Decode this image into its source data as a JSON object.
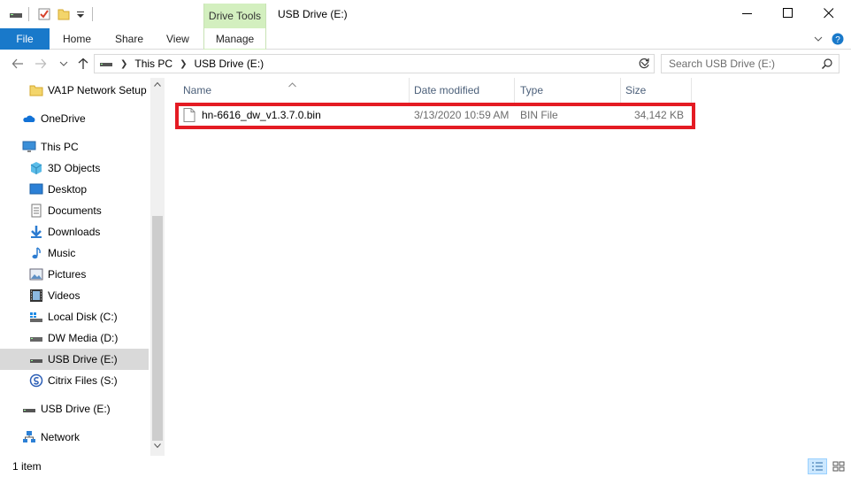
{
  "window": {
    "title": "USB Drive (E:)",
    "context_tab_group": "Drive Tools"
  },
  "ribbon": {
    "tabs": [
      {
        "label": "File"
      },
      {
        "label": "Home"
      },
      {
        "label": "Share"
      },
      {
        "label": "View"
      },
      {
        "label": "Manage"
      }
    ]
  },
  "address": {
    "breadcrumbs": [
      "This PC",
      "USB Drive (E:)"
    ]
  },
  "search": {
    "placeholder": "Search USB Drive (E:)"
  },
  "navpane": {
    "items": [
      {
        "label": "VA1P Network Setup",
        "icon": "folder-icon"
      },
      {
        "label": "OneDrive",
        "icon": "cloud-icon"
      },
      {
        "label": "This PC",
        "icon": "computer-icon"
      },
      {
        "label": "3D Objects",
        "icon": "cube-icon"
      },
      {
        "label": "Desktop",
        "icon": "desktop-icon"
      },
      {
        "label": "Documents",
        "icon": "document-icon"
      },
      {
        "label": "Downloads",
        "icon": "download-arrow-icon"
      },
      {
        "label": "Music",
        "icon": "music-note-icon"
      },
      {
        "label": "Pictures",
        "icon": "picture-icon"
      },
      {
        "label": "Videos",
        "icon": "film-icon"
      },
      {
        "label": "Local Disk (C:)",
        "icon": "windows-drive-icon"
      },
      {
        "label": "DW Media (D:)",
        "icon": "drive-icon"
      },
      {
        "label": "USB Drive (E:)",
        "icon": "usb-drive-icon",
        "selected": true
      },
      {
        "label": "Citrix Files (S:)",
        "icon": "citrix-icon"
      },
      {
        "label": "USB Drive (E:)",
        "icon": "usb-drive-icon"
      },
      {
        "label": "Network",
        "icon": "network-icon"
      }
    ]
  },
  "columns": [
    "Name",
    "Date modified",
    "Type",
    "Size"
  ],
  "files": [
    {
      "name": "hn-6616_dw_v1.3.7.0.bin",
      "date_modified": "3/13/2020 10:59 AM",
      "type": "BIN File",
      "size": "34,142 KB"
    }
  ],
  "status": {
    "item_count": "1 item"
  },
  "colors": {
    "file_tab": "#1979ca",
    "context_tab": "#d3efbf",
    "highlight_box": "#e41b23",
    "column_header_text": "#4c607a"
  }
}
